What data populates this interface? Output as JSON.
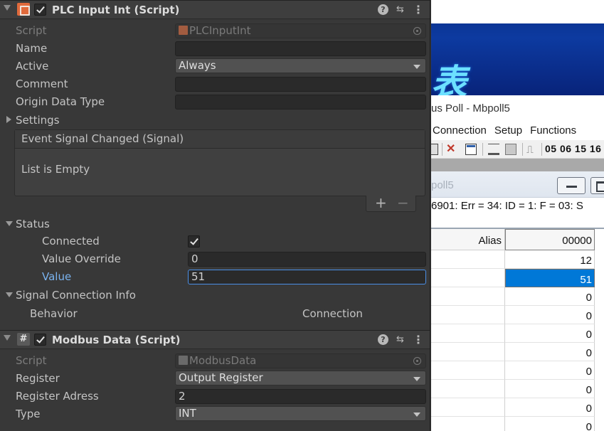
{
  "inspector": {
    "plc_component": {
      "title": "PLC Input Int (Script)",
      "enabled": true,
      "script_label": "Script",
      "script_value": "PLCInputInt",
      "name_label": "Name",
      "name_value": "",
      "active_label": "Active",
      "active_value": "Always",
      "comment_label": "Comment",
      "comment_value": "",
      "origin_label": "Origin Data Type",
      "origin_value": "",
      "settings_label": "Settings",
      "event": {
        "header": "Event Signal Changed (Signal)",
        "empty_text": "List is Empty",
        "add_symbol": "+",
        "remove_symbol": "−"
      },
      "status": {
        "label": "Status",
        "connected_label": "Connected",
        "connected_checked": true,
        "override_label": "Value Override",
        "override_value": "0",
        "value_label": "Value",
        "value_value": "51"
      },
      "signal_info": {
        "label": "Signal Connection Info",
        "behavior_label": "Behavior",
        "connection_label": "Connection"
      }
    },
    "modbus_component": {
      "title": "Modbus Data (Script)",
      "enabled": true,
      "icon_glyph": "#",
      "script_label": "Script",
      "script_value": "ModbusData",
      "register_label": "Register",
      "register_value": "Output Register",
      "address_label": "Register Adress",
      "address_value": "2",
      "type_label": "Type",
      "type_value": "INT"
    },
    "header_icons": [
      "help-icon",
      "preset-icon",
      "more-options-icon"
    ],
    "accent_color": "#4a8fe7"
  },
  "modbus_poll": {
    "banner_text": "表",
    "window_title": "us Poll - Mbpoll5",
    "menu": [
      "Connection",
      "Setup",
      "Functions"
    ],
    "toolbar_text": "05 06 15 16",
    "child_title": "poll5",
    "status_line": "6901: Err = 34: ID = 1: F = 03: S",
    "grid": {
      "alias_header": "Alias",
      "column_header": "00000",
      "values": [
        "12",
        "51",
        "0",
        "0",
        "0",
        "0",
        "0",
        "0",
        "0",
        "0"
      ],
      "selected_index": 1
    },
    "selection_color": "#0078d7"
  }
}
